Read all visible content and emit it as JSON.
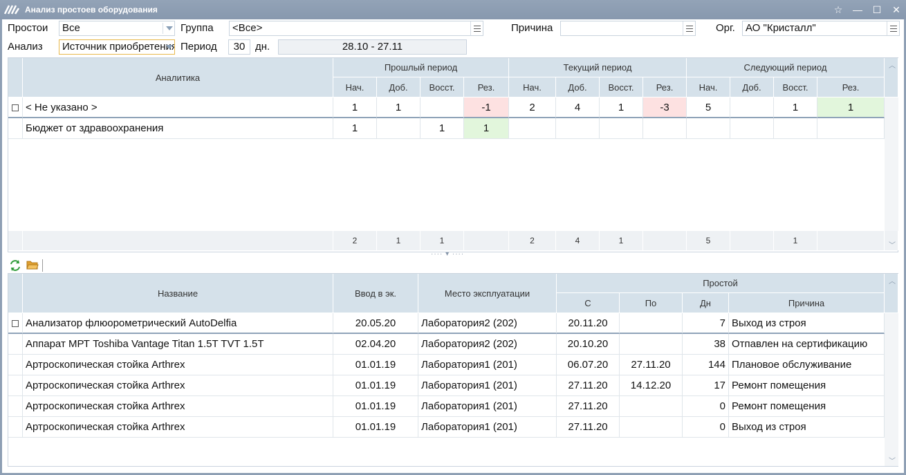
{
  "window": {
    "title": "Анализ простоев оборудования"
  },
  "filters": {
    "downtime_label": "Простои",
    "downtime_value": "Все",
    "group_label": "Группа",
    "group_value": "<Все>",
    "reason_label": "Причина",
    "reason_value": "",
    "org_label": "Орг.",
    "org_value": "АО \"Кристалл\"",
    "analysis_label": "Анализ",
    "analysis_value": "Источник приобретения",
    "period_label": "Период",
    "period_value": "30",
    "period_unit": "дн.",
    "date_range": "28.10 - 27.11"
  },
  "summary": {
    "col_analytics": "Аналитика",
    "groups": [
      "Прошлый период",
      "Текущий период",
      "Следующий период"
    ],
    "subcols": [
      "Нач.",
      "Доб.",
      "Восст.",
      "Рез."
    ],
    "rows": [
      {
        "name": "< Не указано >",
        "vals": [
          "1",
          "1",
          "",
          "-1",
          "2",
          "4",
          "1",
          "-3",
          "5",
          "",
          "1",
          "1"
        ],
        "checkbox": true
      },
      {
        "name": "Бюджет от здравоохранения",
        "vals": [
          "1",
          "",
          "1",
          "1",
          "",
          "",
          "",
          "",
          "",
          "",
          "",
          ""
        ],
        "checkbox": false
      }
    ],
    "totals": [
      "2",
      "1",
      "1",
      "",
      "2",
      "4",
      "1",
      "",
      "5",
      "",
      "1",
      ""
    ]
  },
  "details": {
    "headers": {
      "name": "Название",
      "commission": "Ввод в эк.",
      "location": "Место эксплуатации",
      "downtime": "Простой",
      "from": "С",
      "to": "По",
      "days": "Дн",
      "reason": "Причина"
    },
    "rows": [
      {
        "name": "Анализатор флюорометрический AutoDelfia",
        "commission": "20.05.20",
        "location": "Лаборатория2 (202)",
        "from": "20.11.20",
        "to": "",
        "days": "7",
        "reason": "Выход из строя"
      },
      {
        "name": "Аппарат МРТ Toshiba Vantage Titan 1.5T TVT 1.5T",
        "commission": "02.04.20",
        "location": "Лаборатория2 (202)",
        "from": "20.10.20",
        "to": "",
        "days": "38",
        "reason": "Отпавлен на сертификацию"
      },
      {
        "name": "Артроскопическая стойка Arthrex",
        "commission": "01.01.19",
        "location": "Лаборатория1 (201)",
        "from": "06.07.20",
        "to": "27.11.20",
        "days": "144",
        "reason": "Плановое обслуживание"
      },
      {
        "name": "Артроскопическая стойка Arthrex",
        "commission": "01.01.19",
        "location": "Лаборатория1 (201)",
        "from": "27.11.20",
        "to": "14.12.20",
        "days": "17",
        "reason": "Ремонт помещения"
      },
      {
        "name": "Артроскопическая стойка Arthrex",
        "commission": "01.01.19",
        "location": "Лаборатория1 (201)",
        "from": "27.11.20",
        "to": "",
        "days": "0",
        "reason": "Ремонт помещения"
      },
      {
        "name": "Артроскопическая стойка Arthrex",
        "commission": "01.01.19",
        "location": "Лаборатория1 (201)",
        "from": "27.11.20",
        "to": "",
        "days": "0",
        "reason": "Выход из строя"
      }
    ]
  },
  "icons": {
    "app": "logo-icon",
    "refresh": "refresh-icon",
    "folder": "folder-icon"
  }
}
